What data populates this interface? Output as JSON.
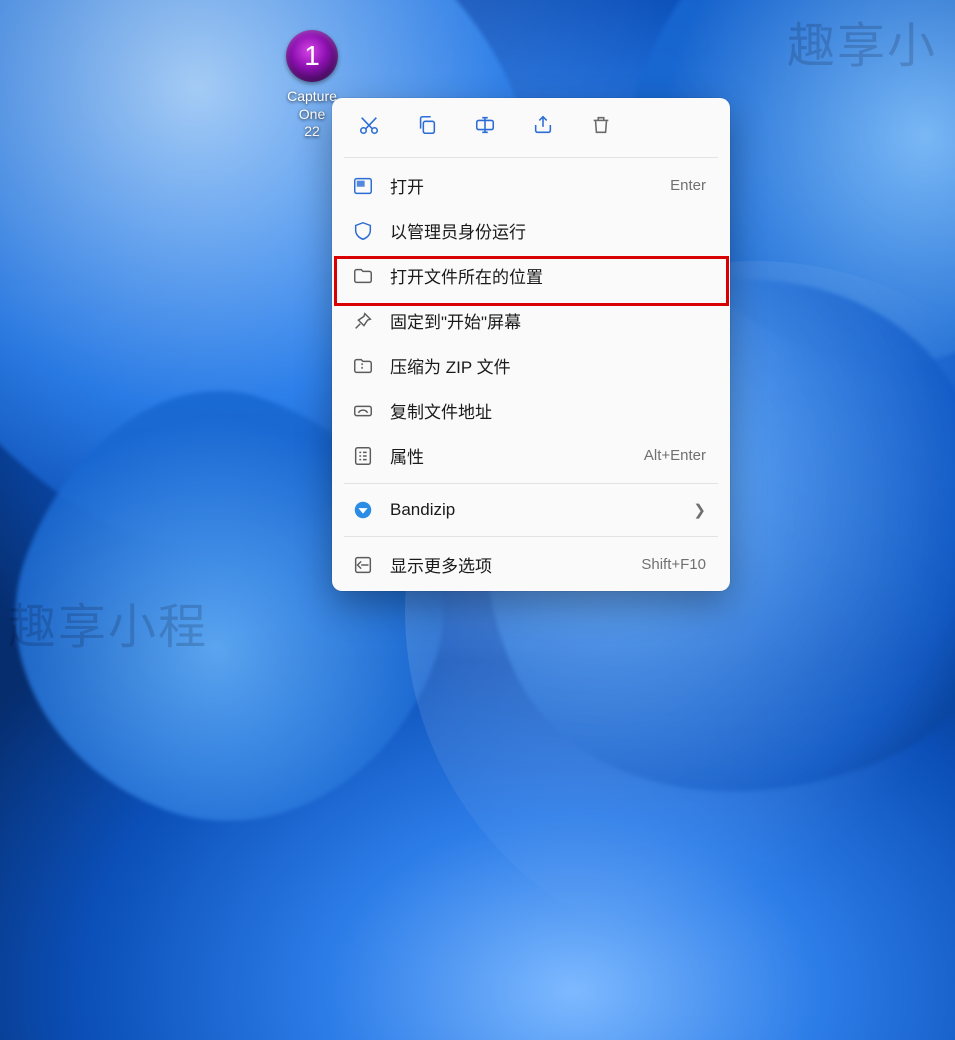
{
  "desktop_icon": {
    "glyph": "1",
    "label": "Capture One\n22"
  },
  "watermarks": {
    "top_right": "趣享小",
    "bottom_left": "趣享小程",
    "center": "趣享小程"
  },
  "context_menu": {
    "top_actions": {
      "cut": "cut",
      "copy": "copy",
      "rename": "rename",
      "share": "share",
      "delete": "delete"
    },
    "items": [
      {
        "id": "open",
        "label": "打开",
        "shortcut": "Enter"
      },
      {
        "id": "run-admin",
        "label": "以管理员身份运行",
        "shortcut": ""
      },
      {
        "id": "open-location",
        "label": "打开文件所在的位置",
        "shortcut": ""
      },
      {
        "id": "pin-start",
        "label": "固定到\"开始\"屏幕",
        "shortcut": ""
      },
      {
        "id": "compress-zip",
        "label": "压缩为 ZIP 文件",
        "shortcut": ""
      },
      {
        "id": "copy-path",
        "label": "复制文件地址",
        "shortcut": ""
      },
      {
        "id": "properties",
        "label": "属性",
        "shortcut": "Alt+Enter"
      },
      {
        "id": "bandizip",
        "label": "Bandizip",
        "shortcut": "",
        "submenu": true
      },
      {
        "id": "show-more",
        "label": "显示更多选项",
        "shortcut": "Shift+F10"
      }
    ]
  }
}
